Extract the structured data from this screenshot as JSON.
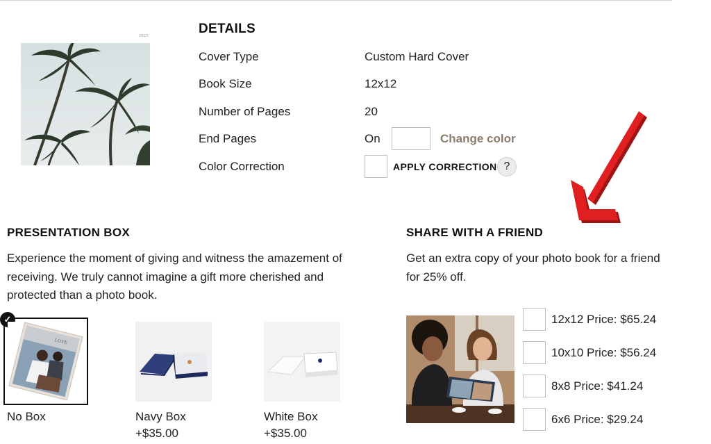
{
  "cover": {
    "year": "2025"
  },
  "details": {
    "title": "DETAILS",
    "rows": [
      {
        "label": "Cover Type",
        "value": "Custom Hard Cover"
      },
      {
        "label": "Book Size",
        "value": "12x12"
      },
      {
        "label": "Number of Pages",
        "value": "20"
      },
      {
        "label": "End Pages",
        "value": "On"
      },
      {
        "label": "Color Correction",
        "value": ""
      }
    ],
    "change_color": "Change color",
    "apply_correction": "APPLY CORRECTION",
    "help": "?"
  },
  "presentation_box": {
    "title": "PRESENTATION BOX",
    "description_lines": [
      "Experience the moment of giving and witness the amazement of",
      "receiving. We truly cannot imagine a gift more cherished and",
      "protected than a photo book."
    ],
    "options": [
      {
        "name": "No Box",
        "price": "",
        "selected": true
      },
      {
        "name": "Navy Box",
        "price": "+$35.00",
        "selected": false
      },
      {
        "name": "White Box",
        "price": "+$35.00",
        "selected": false
      }
    ]
  },
  "share": {
    "title": "SHARE WITH A FRIEND",
    "description_lines": [
      "Get an extra copy of your photo book for a friend",
      "for 25% off."
    ],
    "sizes": [
      {
        "label": "12x12 Price: $65.24"
      },
      {
        "label": "10x10 Price: $56.24"
      },
      {
        "label": "8x8 Price: $41.24"
      },
      {
        "label": "6x6 Price: $29.24"
      }
    ]
  },
  "colors": {
    "accent_link": "#8b7d6b",
    "arrow": "#e02020",
    "text": "#1e1e1e"
  },
  "icons": {
    "check": "check-icon",
    "arrow": "red-arrow-annotation"
  }
}
